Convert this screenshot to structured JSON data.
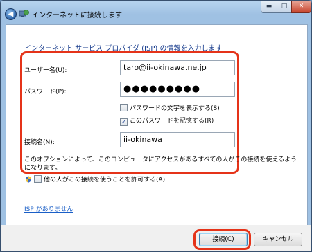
{
  "window": {
    "title": "インターネットに接続します",
    "back_glyph": "◀",
    "min_glyph": "▬",
    "max_glyph": "□",
    "close_glyph": "✕"
  },
  "form": {
    "heading": "インターネット サービス プロバイダ (ISP) の情報を入力します",
    "username_label": "ユーザー名(U):",
    "username_value": "taro@ii-okinawa.ne.jp",
    "password_label": "パスワード(P):",
    "password_value": "●●●●●●●●●",
    "show_chars_label": "パスワードの文字を表示する(S)",
    "show_chars_checked": false,
    "remember_label": "このパスワードを記憶する(R)",
    "remember_checked": true,
    "connection_name_label": "接続名(N):",
    "connection_name_value": "ii-okinawa"
  },
  "option": {
    "note": "このオプションによって、このコンピュータにアクセスがあるすべての人がこの接続を使えるようになります。",
    "allow_others_label": "他の人がこの接続を使うことを許可する(A)",
    "allow_others_checked": false
  },
  "link": {
    "no_isp": "ISP がありません"
  },
  "buttons": {
    "connect": "接続(C)",
    "cancel": "キャンセル"
  },
  "colors": {
    "highlight": "#e53319",
    "heading": "#1a3e8e",
    "link": "#1a5fc7"
  }
}
